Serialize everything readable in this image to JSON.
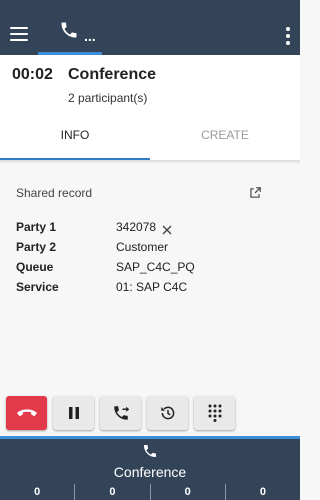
{
  "topbar": {
    "phone_tab_dots": "..."
  },
  "call": {
    "timer": "00:02",
    "title": "Conference",
    "participants": "2 participant(s)"
  },
  "tabs": [
    {
      "label": "INFO",
      "active": true
    },
    {
      "label": "CREATE",
      "active": false
    }
  ],
  "record": {
    "shared_label": "Shared record",
    "details": [
      {
        "key": "Party 1",
        "value": "342078"
      },
      {
        "key": "Party 2",
        "value": "Customer"
      },
      {
        "key": "Queue",
        "value": "SAP_C4C_PQ"
      },
      {
        "key": "Service",
        "value": "01: SAP C4C"
      }
    ]
  },
  "actions": [
    {
      "icon": "hang-up-icon",
      "color": "#e23a4a"
    },
    {
      "icon": "pause-icon"
    },
    {
      "icon": "transfer-call-icon"
    },
    {
      "icon": "history-icon"
    },
    {
      "icon": "dialpad-icon"
    }
  ],
  "bottom": {
    "label": "Conference",
    "counters": [
      "0",
      "0",
      "0",
      "0"
    ]
  },
  "colors": {
    "topbar": "#334459",
    "accent": "#3a8fd8",
    "hangup": "#e23a4a"
  }
}
